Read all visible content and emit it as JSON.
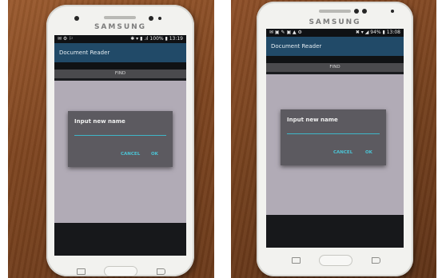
{
  "photos": [
    {
      "brand": "SAMSUNG",
      "status": {
        "left": "✉ ⚙ ⚐",
        "right": "✱ ▾ ▮ .ıl 100% ▮ 13:19"
      },
      "app_title": "Document Reader",
      "find_label": "FIND",
      "dialog": {
        "title": "Input new name",
        "cancel": "CANCEL",
        "ok": "OK"
      }
    },
    {
      "brand": "SAMSUNG",
      "status": {
        "left": "✉ ▣ ✎ ▣ ▲ ⚙",
        "right": "✖ ▾ ◢ 94% ▮ 13:08"
      },
      "app_title": "Document Reader",
      "find_label": "FIND",
      "dialog": {
        "title": "Input new name",
        "cancel": "CANCEL",
        "ok": "OK"
      }
    }
  ]
}
